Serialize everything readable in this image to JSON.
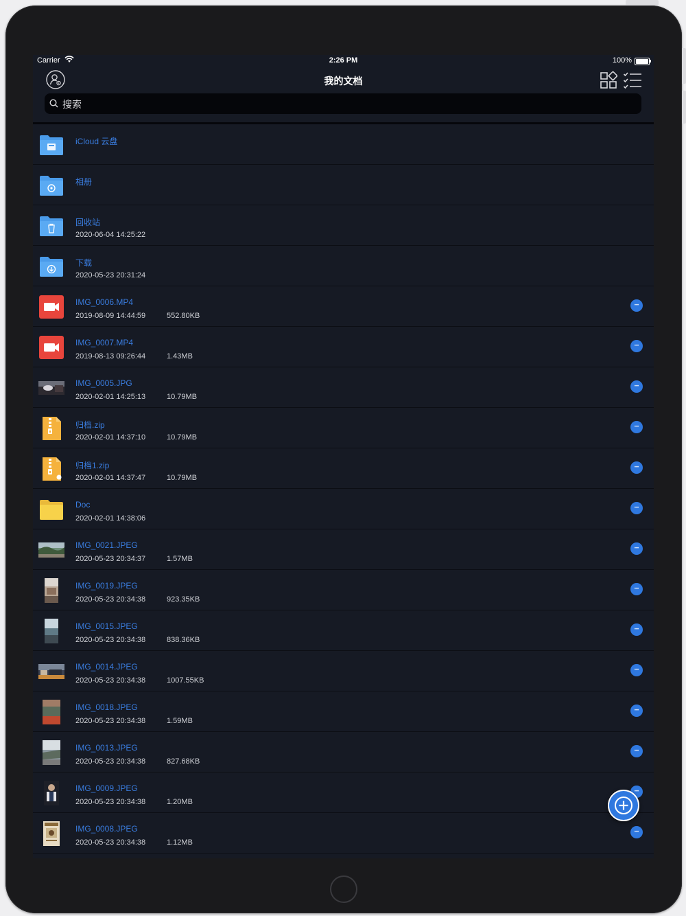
{
  "status_bar": {
    "carrier": "Carrier",
    "time": "2:26 PM",
    "battery": "100%"
  },
  "nav": {
    "title": "我的文档"
  },
  "search": {
    "placeholder": "搜索"
  },
  "files": [
    {
      "name": "iCloud 云盘",
      "date": "",
      "size": "",
      "icon": "icloud-folder-icon"
    },
    {
      "name": "相册",
      "date": "",
      "size": "",
      "icon": "photos-folder-icon"
    },
    {
      "name": "回收站",
      "date": "2020-06-04 14:25:22",
      "size": "",
      "icon": "trash-folder-icon"
    },
    {
      "name": "下载",
      "date": "2020-05-23 20:31:24",
      "size": "",
      "icon": "download-folder-icon"
    },
    {
      "name": "IMG_0006.MP4",
      "date": "2019-08-09 14:44:59",
      "size": "552.80KB",
      "icon": "video-icon"
    },
    {
      "name": "IMG_0007.MP4",
      "date": "2019-08-13 09:26:44",
      "size": "1.43MB",
      "icon": "video-icon"
    },
    {
      "name": "IMG_0005.JPG",
      "date": "2020-02-01 14:25:13",
      "size": "10.79MB",
      "icon": "image-thumbnail"
    },
    {
      "name": "归档.zip",
      "date": "2020-02-01 14:37:10",
      "size": "10.79MB",
      "icon": "zip-icon"
    },
    {
      "name": "归档1.zip",
      "date": "2020-02-01 14:37:47",
      "size": "10.79MB",
      "icon": "zip-icon"
    },
    {
      "name": "Doc",
      "date": "2020-02-01 14:38:06",
      "size": "",
      "icon": "yellow-folder-icon"
    },
    {
      "name": "IMG_0021.JPEG",
      "date": "2020-05-23 20:34:37",
      "size": "1.57MB",
      "icon": "image-thumbnail"
    },
    {
      "name": "IMG_0019.JPEG",
      "date": "2020-05-23 20:34:38",
      "size": "923.35KB",
      "icon": "image-thumbnail"
    },
    {
      "name": "IMG_0015.JPEG",
      "date": "2020-05-23 20:34:38",
      "size": "838.36KB",
      "icon": "image-thumbnail"
    },
    {
      "name": "IMG_0014.JPEG",
      "date": "2020-05-23 20:34:38",
      "size": "1007.55KB",
      "icon": "image-thumbnail"
    },
    {
      "name": "IMG_0018.JPEG",
      "date": "2020-05-23 20:34:38",
      "size": "1.59MB",
      "icon": "image-thumbnail"
    },
    {
      "name": "IMG_0013.JPEG",
      "date": "2020-05-23 20:34:38",
      "size": "827.68KB",
      "icon": "image-thumbnail"
    },
    {
      "name": "IMG_0009.JPEG",
      "date": "2020-05-23 20:34:38",
      "size": "1.20MB",
      "icon": "image-thumbnail"
    },
    {
      "name": "IMG_0008.JPEG",
      "date": "2020-05-23 20:34:38",
      "size": "1.12MB",
      "icon": "image-thumbnail"
    }
  ],
  "colors": {
    "background": "#161a24",
    "accent": "#2f78df",
    "file_name": "#3a7de0",
    "folder_blue": "#4a9bea",
    "video_red": "#e8453c",
    "zip_yellow": "#f5b23d",
    "folder_yellow": "#f7d24a"
  }
}
